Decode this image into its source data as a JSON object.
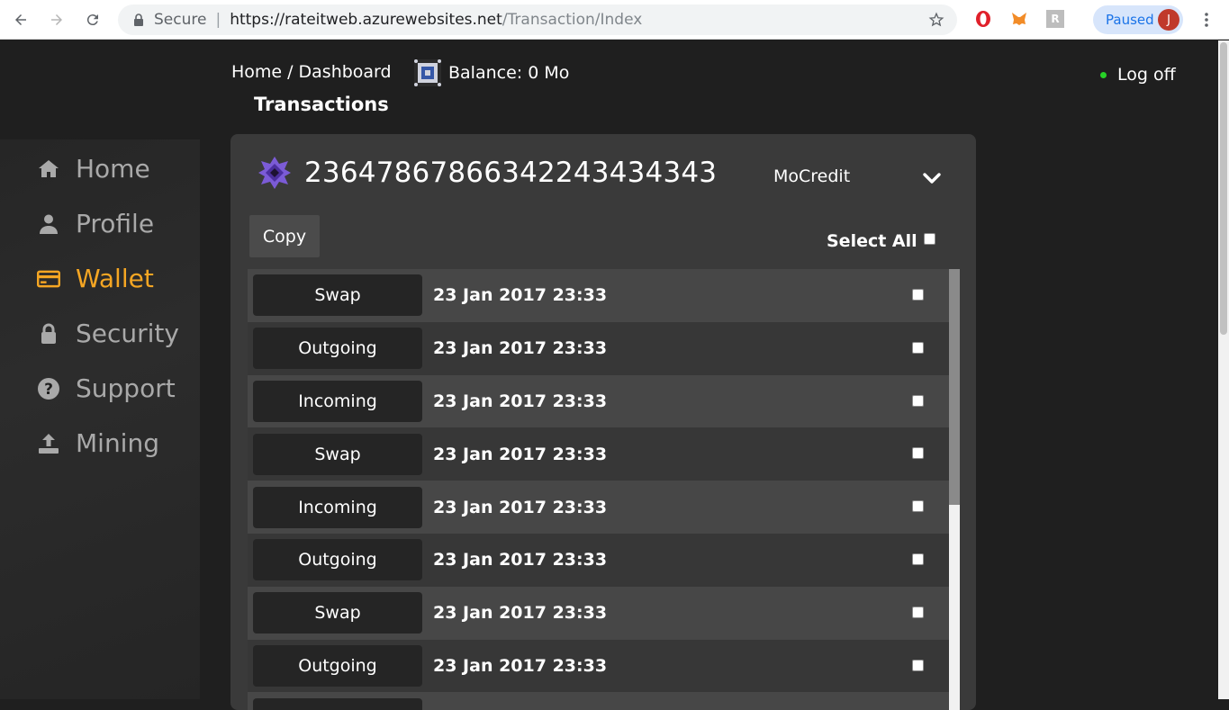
{
  "browser": {
    "secure_label": "Secure",
    "url_host": "https://rateitweb.azurewebsites.net",
    "url_path": "/Transaction/Index",
    "profile_status": "Paused",
    "profile_initial": "J",
    "ext_r_label": "R"
  },
  "header": {
    "home_link": "Home",
    "crumb_sep": "/",
    "dashboard_link": "Dashboard",
    "balance": "Balance: 0 Mo",
    "page_title": "Transactions",
    "logoff": "Log off"
  },
  "sidebar": {
    "items": [
      {
        "label": "Home",
        "icon": "home-icon",
        "active": false
      },
      {
        "label": "Profile",
        "icon": "user-icon",
        "active": false
      },
      {
        "label": "Wallet",
        "icon": "wallet-icon",
        "active": true
      },
      {
        "label": "Security",
        "icon": "lock-icon",
        "active": false
      },
      {
        "label": "Support",
        "icon": "question-icon",
        "active": false
      },
      {
        "label": "Mining",
        "icon": "upload-icon",
        "active": false
      }
    ],
    "active_color": "#f5a623"
  },
  "wallet": {
    "id": "2364786786634224343434 3",
    "currency": "MoCredit",
    "copy_label": "Copy",
    "select_all_label": "Select All"
  },
  "transactions": [
    {
      "type": "Swap",
      "date": "23 Jan 2017 23:33"
    },
    {
      "type": "Outgoing",
      "date": "23 Jan 2017 23:33"
    },
    {
      "type": "Incoming",
      "date": "23 Jan 2017 23:33"
    },
    {
      "type": "Swap",
      "date": "23 Jan 2017 23:33"
    },
    {
      "type": "Incoming",
      "date": "23 Jan 2017 23:33"
    },
    {
      "type": "Outgoing",
      "date": "23 Jan 2017 23:33"
    },
    {
      "type": "Swap",
      "date": "23 Jan 2017 23:33"
    },
    {
      "type": "Outgoing",
      "date": "23 Jan 2017 23:33"
    }
  ]
}
